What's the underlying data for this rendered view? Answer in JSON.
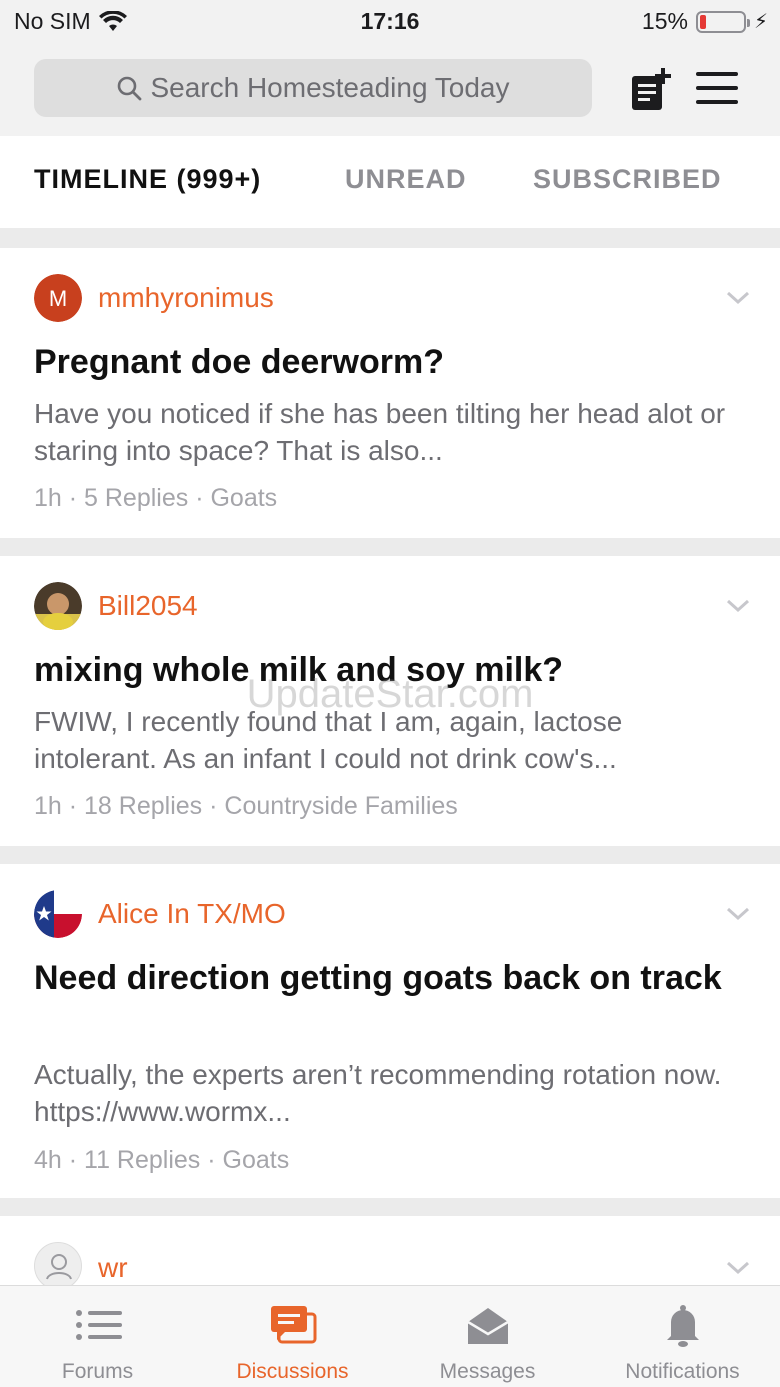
{
  "status_bar": {
    "carrier": "No SIM",
    "time": "17:16",
    "battery_percent": "15%",
    "battery_level": 0.15,
    "battery_color": "#e53935"
  },
  "header": {
    "search_placeholder": "Search Homesteading Today",
    "icons": [
      "search-icon",
      "new-post-icon",
      "menu-icon"
    ]
  },
  "tabs": [
    {
      "label": "TIMELINE (999+)",
      "active": true
    },
    {
      "label": "UNREAD",
      "active": false
    },
    {
      "label": "SUBSCRIBED",
      "active": false
    }
  ],
  "posts": [
    {
      "avatar_letter": "M",
      "avatar_color": "#c8401e",
      "author": "mmhyronimus",
      "title": "Pregnant doe deerworm?",
      "excerpt": "Have you noticed if she has been tilting her head alot or staring into space? That is also...",
      "time": "1h",
      "replies": "5 Replies",
      "forum": "Goats"
    },
    {
      "avatar_type": "photo",
      "author": "Bill2054",
      "title": "mixing whole milk and soy milk?",
      "excerpt": "FWIW, I recently found that I am, again, lactose intolerant. As an infant I could not drink cow's...",
      "time": "1h",
      "replies": "18 Replies",
      "forum": "Countryside Families"
    },
    {
      "avatar_type": "texas-flag",
      "author": "Alice In TX/MO",
      "title": "Need direction getting goats back on track",
      "excerpt": "Actually, the experts aren’t recommending rotation now.  https://www.wormx...",
      "time": "4h",
      "replies": "11 Replies",
      "forum": "Goats"
    },
    {
      "avatar_type": "default-user",
      "author": "wr"
    }
  ],
  "watermark": "UpdateStar.com",
  "bottom_nav": [
    {
      "label": "Forums",
      "icon": "list-icon",
      "active": false
    },
    {
      "label": "Discussions",
      "icon": "discussions-icon",
      "active": true
    },
    {
      "label": "Messages",
      "icon": "envelope-icon",
      "active": false
    },
    {
      "label": "Notifications",
      "icon": "bell-icon",
      "active": false
    }
  ],
  "colors": {
    "accent": "#e8652b",
    "inactive": "#8e8e93"
  }
}
